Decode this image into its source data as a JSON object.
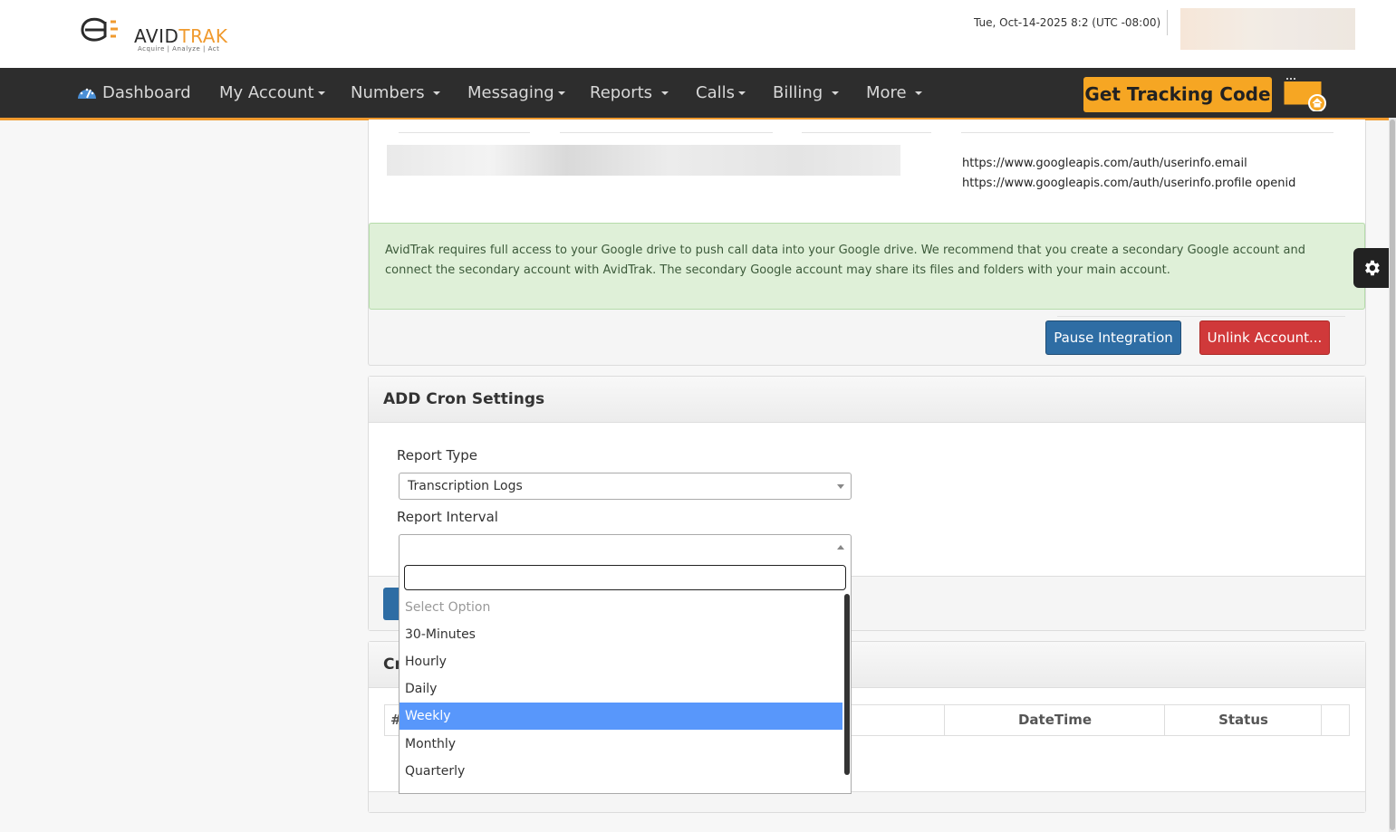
{
  "header": {
    "logo_text_1": "A",
    "logo_text_2": "VID",
    "logo_text_3": "TRAK",
    "logo_tagline": "Acquire | Analyze | Act",
    "datetime": "Tue, Oct-14-2025 8:2 (UTC -08:00)"
  },
  "nav": {
    "items": [
      {
        "label": "Dashboard"
      },
      {
        "label": "My Account"
      },
      {
        "label": "Numbers"
      },
      {
        "label": "Messaging"
      },
      {
        "label": "Reports"
      },
      {
        "label": "Calls"
      },
      {
        "label": "Billing"
      },
      {
        "label": "More"
      }
    ],
    "tracking_button": "Get Tracking Code"
  },
  "integration": {
    "scopes": [
      "https://www.googleapis.com/auth/userinfo.email",
      "https://www.googleapis.com/auth/userinfo.profile openid"
    ],
    "alert": "AvidTrak requires full access to your Google drive to push call data into your Google drive. We recommend that you create a secondary Google account and connect the secondary account with AvidTrak. The secondary Google account may share its files and folders with your main account.",
    "pause_button": "Pause Integration",
    "unlink_button": "Unlink Account..."
  },
  "cron": {
    "title": "ADD Cron Settings",
    "report_type_label": "Report Type",
    "report_type_value": "Transcription Logs",
    "report_interval_label": "Report Interval",
    "report_interval_value": ""
  },
  "cron_list": {
    "title_partial": "Cr",
    "col_hash": "#",
    "col_datetime": "DateTime",
    "col_status": "Status"
  },
  "dropdown": {
    "search_value": "",
    "options": [
      {
        "label": "Select Option",
        "state": "placeholder"
      },
      {
        "label": "30-Minutes",
        "state": "normal"
      },
      {
        "label": "Hourly",
        "state": "normal"
      },
      {
        "label": "Daily",
        "state": "normal"
      },
      {
        "label": "Weekly",
        "state": "highlighted"
      },
      {
        "label": "Monthly",
        "state": "normal"
      },
      {
        "label": "Quarterly",
        "state": "normal"
      }
    ]
  },
  "colors": {
    "nav_bg": "#2d2d2d",
    "accent_orange": "#f6a623",
    "primary_blue": "#2e6da4",
    "danger_red": "#d0393a",
    "success_bg": "#dff0d8",
    "highlight_blue": "#5897fb"
  }
}
